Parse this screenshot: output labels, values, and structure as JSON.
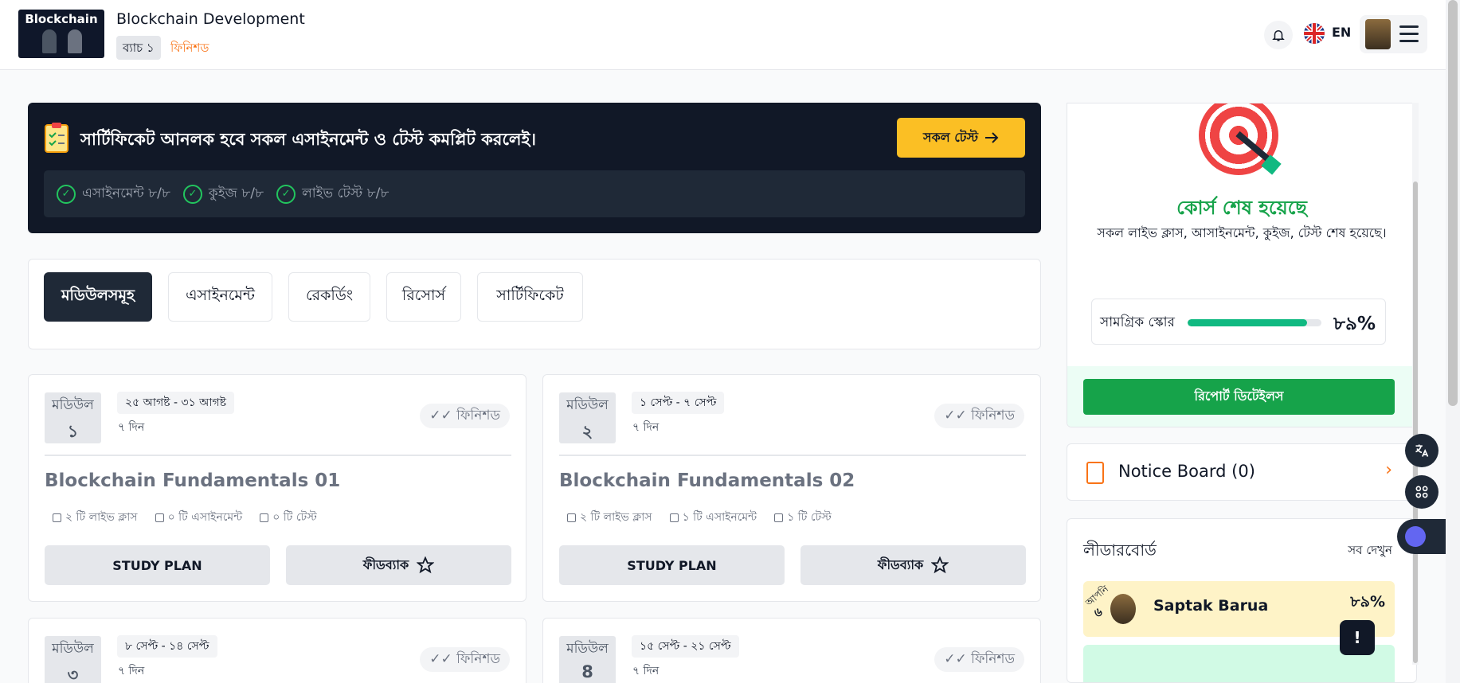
{
  "header": {
    "thumbnail_text": "Blockchain",
    "course_title": "Blockchain Development",
    "batch": "ব্যাচ ১",
    "status": "ফিনিশড",
    "language": "EN"
  },
  "banner": {
    "text": "সার্টিফিকেট আনলক হবে সকল এসাইনমেন্ট ও টেস্ট কমপ্লিট করলেই।",
    "button_label": "সকল টেস্ট",
    "stats": [
      {
        "label": "এসাইনমেন্ট ৮/৮"
      },
      {
        "label": "কুইজ ৮/৮"
      },
      {
        "label": "লাইভ টেস্ট ৮/৮"
      }
    ]
  },
  "tabs": [
    {
      "label": "মডিউলসমূহ",
      "active": true
    },
    {
      "label": "এসাইনমেন্ট"
    },
    {
      "label": "রেকর্ডিং"
    },
    {
      "label": "রিসোর্স"
    },
    {
      "label": "সার্টিফিকেট"
    }
  ],
  "modules": [
    {
      "label": "মডিউল",
      "number": "১",
      "date": "২৫ আগষ্ট - ৩১ আগষ্ট",
      "days": "৭ দিন",
      "status": "ফিনিশড",
      "title": "Blockchain Fundamentals 01",
      "live_classes": "২ টি লাইভ ক্লাস",
      "assignments": "০ টি এসাইনমেন্ট",
      "tests": "০ টি টেস্ট",
      "study_plan": "STUDY PLAN",
      "feedback": "ফীডব্যাক"
    },
    {
      "label": "মডিউল",
      "number": "২",
      "date": "১ সেপ্ট - ৭ সেপ্ট",
      "days": "৭ দিন",
      "status": "ফিনিশড",
      "title": "Blockchain Fundamentals 02",
      "live_classes": "২ টি লাইভ ক্লাস",
      "assignments": "১ টি এসাইনমেন্ট",
      "tests": "১ টি টেস্ট",
      "study_plan": "STUDY PLAN",
      "feedback": "ফীডব্যাক"
    },
    {
      "label": "মডিউল",
      "number": "৩",
      "date": "৮ সেপ্ট - ১৪ সেপ্ট",
      "days": "৭ দিন",
      "status": "ফিনিশড"
    },
    {
      "label": "মডিউল",
      "number": "8",
      "date": "১৫ সেপ্ট - ২১ সেপ্ট",
      "days": "৭ দিন",
      "status": "ফিনিশড"
    }
  ],
  "progress": {
    "title": "কোর্স শেষ হয়েছে",
    "subtitle": "সকল লাইভ ক্লাস, আসাইনমেন্ট, কুইজ, টেস্ট শেষ হয়েছে।",
    "score_label": "সামগ্রিক স্কোর",
    "score_value": "৮৯%",
    "score_fraction": 0.89,
    "report_button": "রিপোর্ট ডিটেইলস"
  },
  "notice": {
    "title": "Notice Board (0)"
  },
  "leaderboard": {
    "title": "লীডারবোর্ড",
    "see_all": "সব দেখুন",
    "you_label": "আপনি",
    "rank": "৬",
    "name": "Saptak Barua",
    "score": "৮৯%"
  },
  "icons": {
    "check": "check-circle-icon",
    "arrow": "arrow-right-icon",
    "star": "star-icon",
    "bell": "bell-icon"
  },
  "colors": {
    "accent_yellow": "#fbbf24",
    "success_green": "#16a34a",
    "status_orange": "#f97316",
    "dark": "#111827"
  }
}
